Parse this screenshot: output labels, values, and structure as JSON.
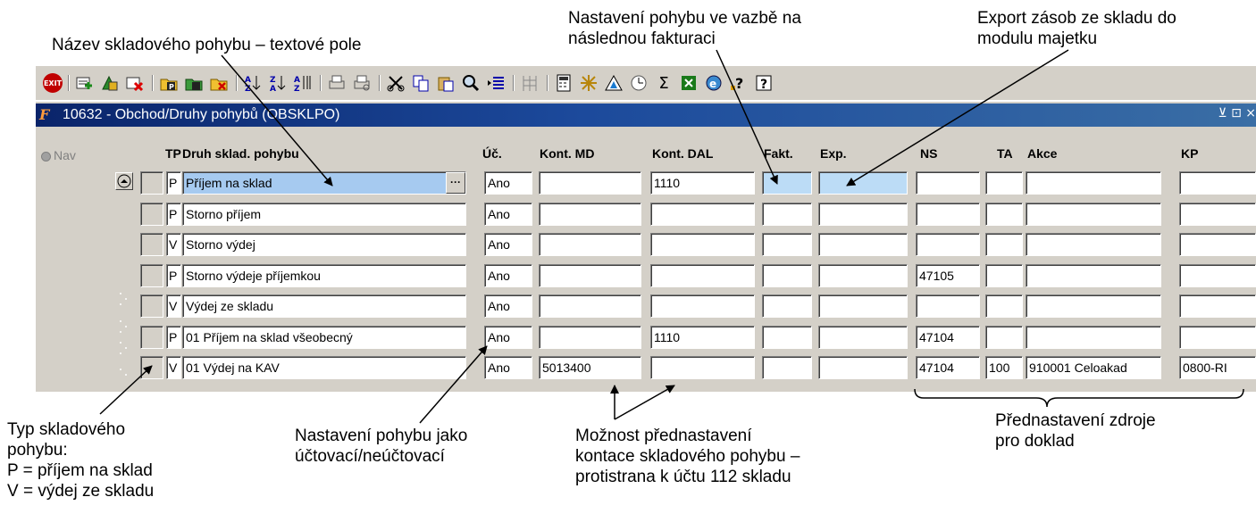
{
  "annotations": {
    "name_field": "Název skladového pohybu – textové pole",
    "fakt_line1": "Nastavení pohybu ve vazbě na",
    "fakt_line2": "následnou fakturaci",
    "exp_line1": "Export zásob ze skladu do",
    "exp_line2": "modulu majetku",
    "type_line1": "Typ skladového",
    "type_line2": "pohybu:",
    "type_line3": "P = příjem na sklad",
    "type_line4": "V = výdej ze skladu",
    "uc_line1": "Nastavení pohybu jako",
    "uc_line2": "účtovací/neúčtovací",
    "kont_line1": "Možnost přednastavení",
    "kont_line2": "kontace skladového pohybu –",
    "kont_line3": "protistrana k účtu 112 skladu",
    "zdroj_line1": "Přednastavení zdroje",
    "zdroj_line2": "pro doklad"
  },
  "toolbar": {
    "icons": [
      "exit-icon",
      "insert-record-icon",
      "save-record-icon",
      "delete-record-icon",
      "folder-p-icon",
      "folder-copy-icon",
      "folder-delete-icon",
      "sort-ascending-icon",
      "sort-descending-icon",
      "sort-multi-icon",
      "print-icon",
      "print-preview-icon",
      "cut-icon",
      "copy-icon",
      "paste-icon",
      "find-icon",
      "indent-icon",
      "columns-icon",
      "calculator-icon",
      "network-icon",
      "triangle-icon",
      "clock-icon",
      "sum-icon",
      "excel-icon",
      "browser-icon",
      "help-question-icon",
      "help-context-icon"
    ],
    "exit_label": "EXIT",
    "sum_glyph": "Σ"
  },
  "window": {
    "logo": "F",
    "title": "10632 - Obchod/Druhy pohybů (OBSKLPO)",
    "controls": "⊻ ⊡ ×"
  },
  "nav_label": "Nav",
  "columns": {
    "tp": "TP",
    "druh": "Druh sklad. pohybu",
    "uc": "Úč.",
    "md": "Kont. MD",
    "dal": "Kont. DAL",
    "fakt": "Fakt.",
    "exp": "Exp.",
    "ns": "NS",
    "ta": "TA",
    "akce": "Akce",
    "kp": "KP"
  },
  "rows": [
    {
      "tp": "P",
      "name": "Příjem na sklad",
      "uc": "Ano",
      "md": "",
      "dal": "1110",
      "fakt": "",
      "exp": "",
      "ns": "",
      "ta": "",
      "akce": "",
      "kp": ""
    },
    {
      "tp": "P",
      "name": "Storno příjem",
      "uc": "Ano",
      "md": "",
      "dal": "",
      "fakt": "",
      "exp": "",
      "ns": "",
      "ta": "",
      "akce": "",
      "kp": ""
    },
    {
      "tp": "V",
      "name": "Storno výdej",
      "uc": "Ano",
      "md": "",
      "dal": "",
      "fakt": "",
      "exp": "",
      "ns": "",
      "ta": "",
      "akce": "",
      "kp": ""
    },
    {
      "tp": "P",
      "name": "Storno výdeje příjemkou",
      "uc": "Ano",
      "md": "",
      "dal": "",
      "fakt": "",
      "exp": "",
      "ns": "47105",
      "ta": "",
      "akce": "",
      "kp": ""
    },
    {
      "tp": "V",
      "name": "Výdej ze skladu",
      "uc": "Ano",
      "md": "",
      "dal": "",
      "fakt": "",
      "exp": "",
      "ns": "",
      "ta": "",
      "akce": "",
      "kp": ""
    },
    {
      "tp": "P",
      "name": "01 Příjem na sklad všeobecný",
      "uc": "Ano",
      "md": "",
      "dal": "1110",
      "fakt": "",
      "exp": "",
      "ns": "47104",
      "ta": "",
      "akce": "",
      "kp": ""
    },
    {
      "tp": "V",
      "name": "01 Výdej na KAV",
      "uc": "Ano",
      "md": "5013400",
      "dal": "",
      "fakt": "",
      "exp": "",
      "ns": "47104",
      "ta": "100",
      "akce": "910001 Celoakad",
      "kp": "0800-RI"
    }
  ],
  "lov_button_label": "···"
}
